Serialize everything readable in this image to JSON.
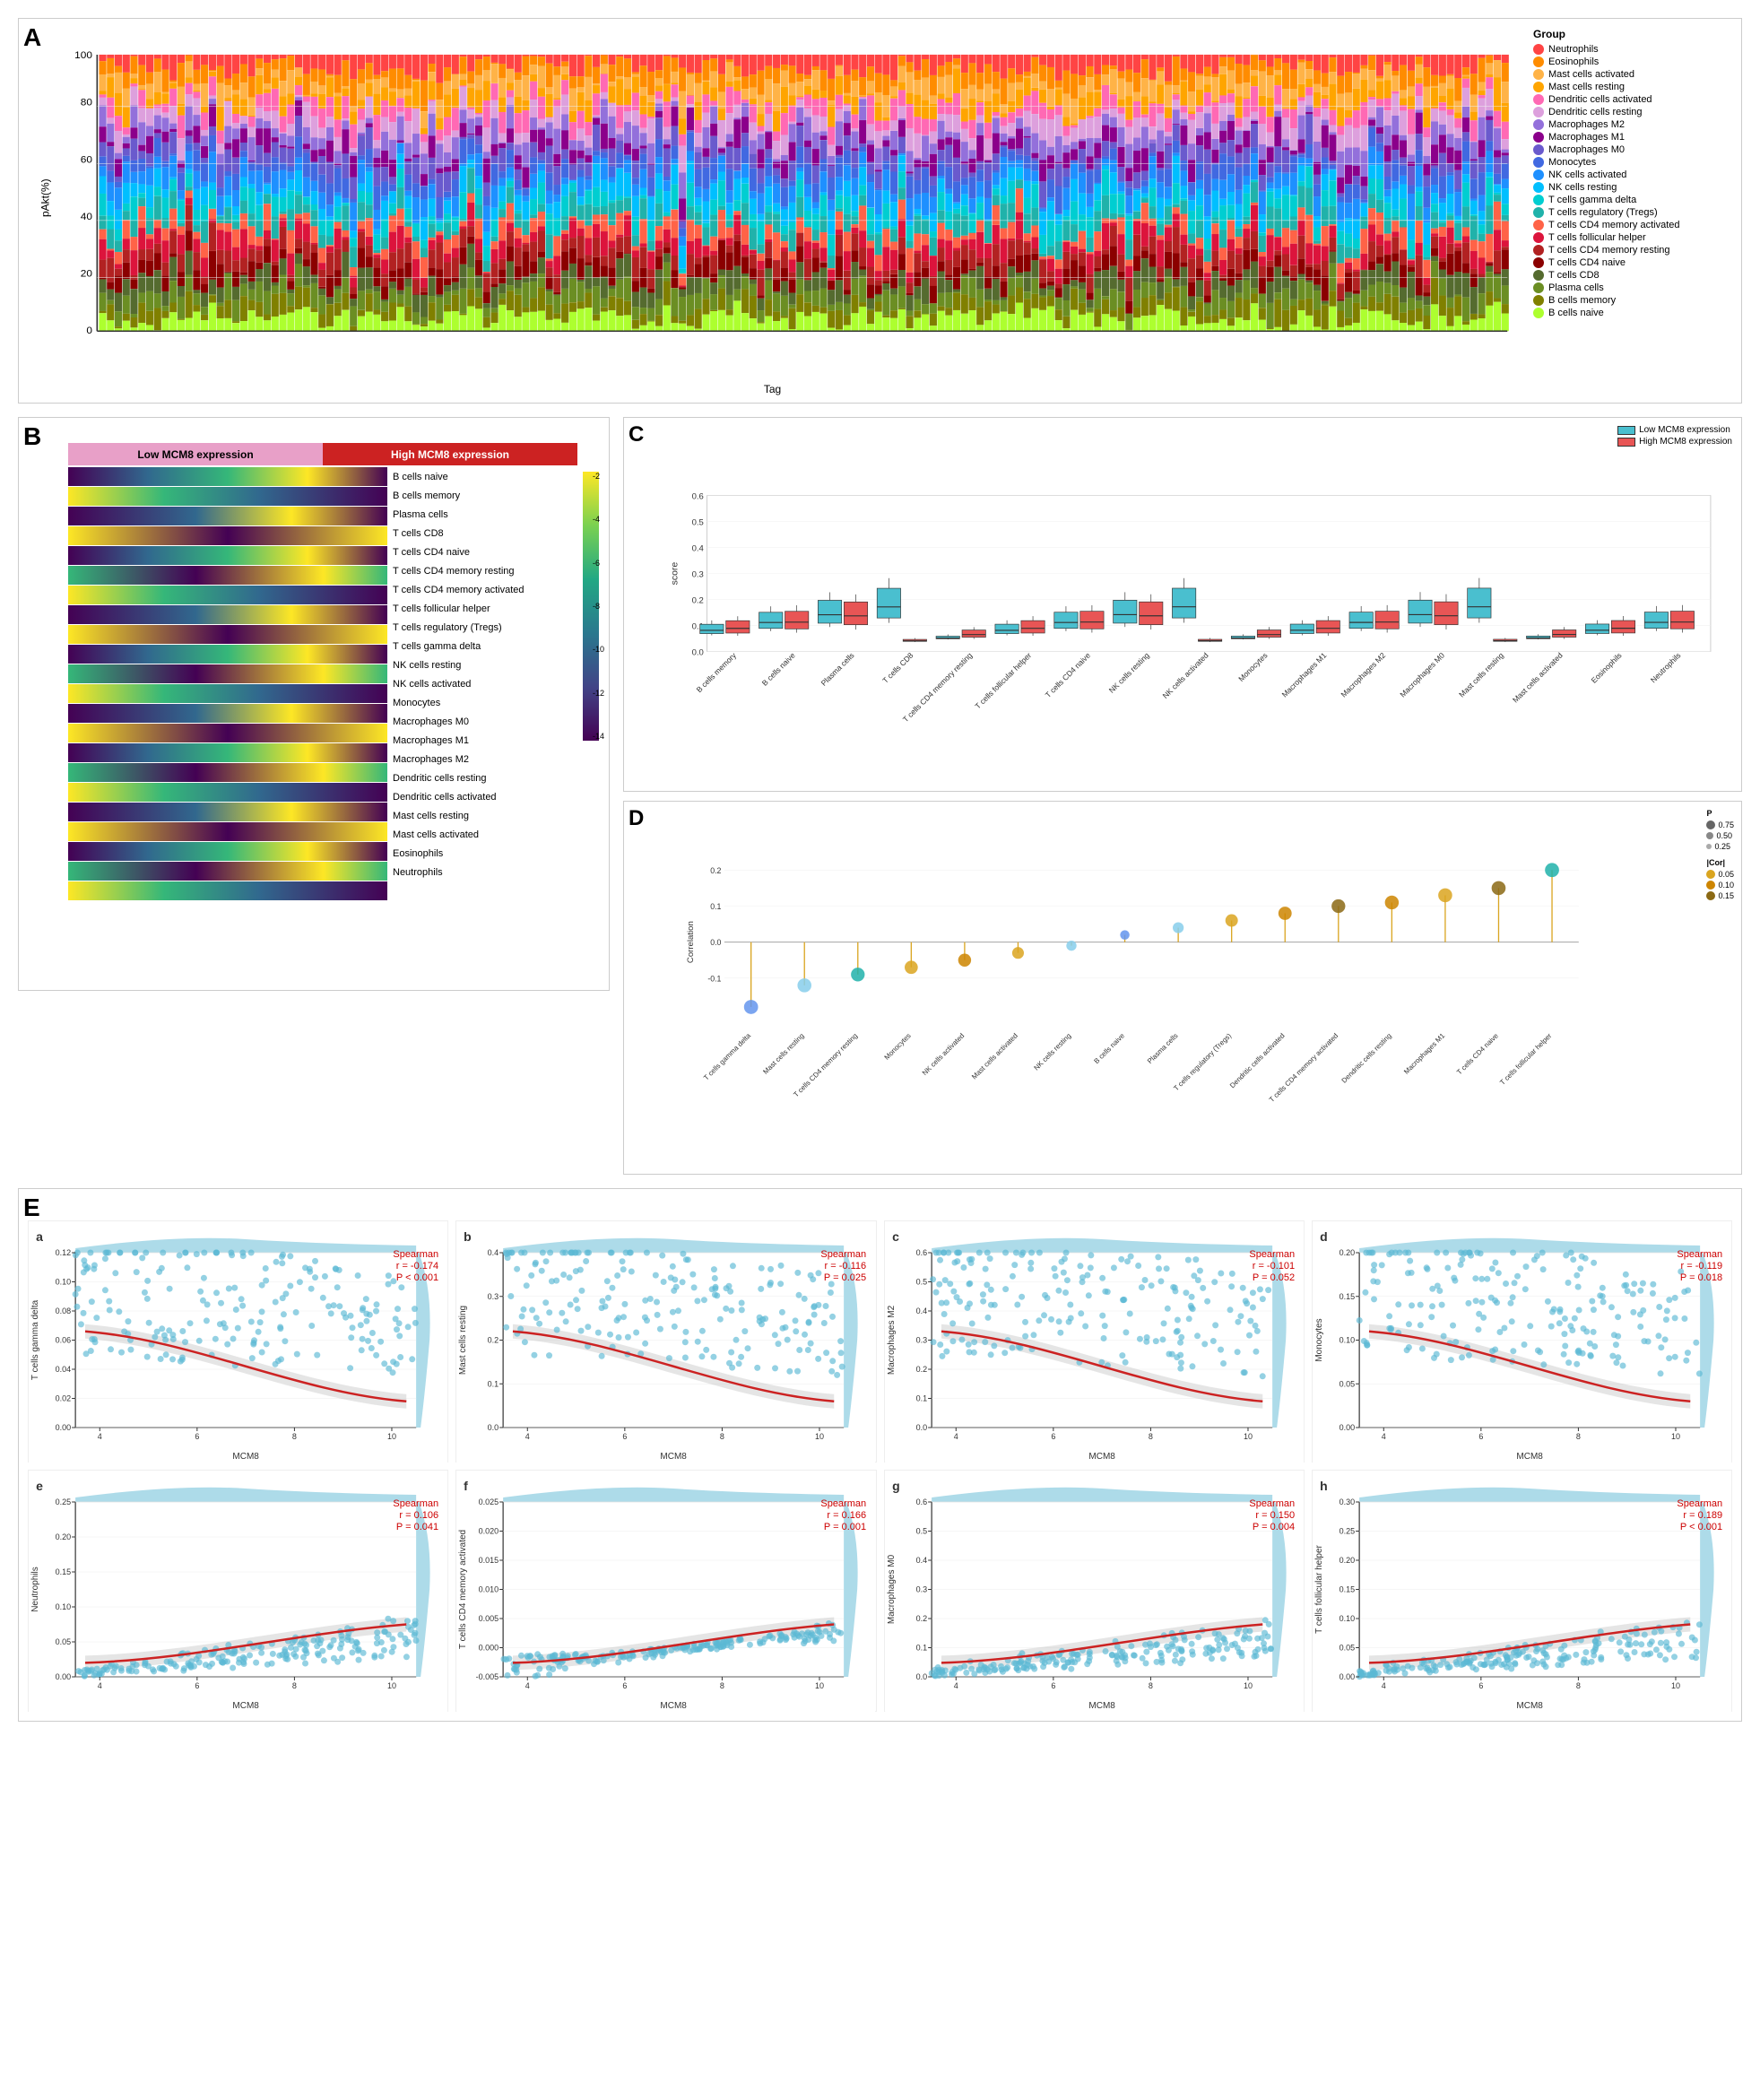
{
  "panels": {
    "a": {
      "label": "A",
      "y_axis": "pAkt(%)",
      "x_axis": "Tag",
      "y_ticks": [
        "0",
        "20",
        "40",
        "60",
        "80",
        "100"
      ],
      "legend_title": "Group",
      "legend_items": [
        {
          "name": "Neutrophils",
          "color": "#FF4444"
        },
        {
          "name": "Eosinophils",
          "color": "#FF8C00"
        },
        {
          "name": "Mast cells activated",
          "color": "#FFB347"
        },
        {
          "name": "Mast cells resting",
          "color": "#FFA500"
        },
        {
          "name": "Dendritic cells activated",
          "color": "#FF69B4"
        },
        {
          "name": "Dendritic cells resting",
          "color": "#DDA0DD"
        },
        {
          "name": "Macrophages M2",
          "color": "#9370DB"
        },
        {
          "name": "Macrophages M1",
          "color": "#8B008B"
        },
        {
          "name": "Macrophages M0",
          "color": "#6A5ACD"
        },
        {
          "name": "Monocytes",
          "color": "#4169E1"
        },
        {
          "name": "NK cells activated",
          "color": "#1E90FF"
        },
        {
          "name": "NK cells resting",
          "color": "#00BFFF"
        },
        {
          "name": "T cells gamma delta",
          "color": "#00CED1"
        },
        {
          "name": "T cells regulatory (Tregs)",
          "color": "#20B2AA"
        },
        {
          "name": "T cells CD4 memory activated",
          "color": "#FF6347"
        },
        {
          "name": "T cells follicular helper",
          "color": "#DC143C"
        },
        {
          "name": "T cells CD4 memory resting",
          "color": "#B22222"
        },
        {
          "name": "T cells CD4 naive",
          "color": "#8B0000"
        },
        {
          "name": "T cells CD8",
          "color": "#556B2F"
        },
        {
          "name": "Plasma cells",
          "color": "#6B8E23"
        },
        {
          "name": "B cells memory",
          "color": "#808000"
        },
        {
          "name": "B cells naive",
          "color": "#ADFF2F"
        }
      ]
    },
    "b": {
      "label": "B",
      "low_label": "Low MCM8 expression",
      "high_label": "High MCM8 expression",
      "cell_types": [
        "B cells naive",
        "B cells memory",
        "Plasma cells",
        "T cells CD8",
        "T cells CD4 naive",
        "T cells CD4 memory resting",
        "T cells CD4 memory activated",
        "T cells follicular helper",
        "T cells regulatory (Tregs)",
        "T cells gamma delta",
        "NK cells resting",
        "NK cells activated",
        "Monocytes",
        "Macrophages M0",
        "Macrophages M1",
        "Macrophages M2",
        "Dendritic cells resting",
        "Dendritic cells activated",
        "Mast cells resting",
        "Mast cells activated",
        "Eosinophils",
        "Neutrophils"
      ],
      "colorbar_values": [
        "-2",
        "-4",
        "-6",
        "-8",
        "-10",
        "-12",
        "-14"
      ]
    },
    "c": {
      "label": "C",
      "legend": {
        "low": "Low MCM8 expression",
        "high": "High MCM8 expression"
      },
      "x_labels": [
        "B cells memory",
        "B cells naive",
        "Plasma cells",
        "T cells CD8",
        "T cells CD4 memory resting",
        "T cells follicular helper",
        "T cells CD4 naive",
        "NK cells resting",
        "NK cells activated",
        "Monocytes",
        "Macrophages M1",
        "Macrophages M2",
        "Macrophages M0",
        "Mast cells resting",
        "Mast cells activated",
        "Eosinophils",
        "Neutrophils"
      ]
    },
    "d": {
      "label": "D",
      "y_label": "Correlation",
      "p_legend": [
        "0.75",
        "0.50",
        "0.25"
      ],
      "cor_legend": [
        "0.05",
        "0.10",
        "0.15"
      ],
      "x_labels": [
        "T cells gamma delta",
        "Mast cells resting",
        "T cells CD4 memory resting",
        "Monocytes",
        "NK cells activated",
        "Mast cells activated",
        "NK cells resting",
        "B cells naive",
        "Plasma cells",
        "T cells regulatory (Tregs)",
        "Dendritic cells activated",
        "T cells CD4 memory activated",
        "Dendritic cells resting",
        "Macrophages M1",
        "T cells CD4 naive",
        "T cells follicular helper"
      ]
    },
    "e": {
      "label": "E",
      "subplots": [
        {
          "id": "a",
          "y_label": "T cells gamma delta",
          "x_label": "MCM8",
          "spearman": "Spearman",
          "r": "r = -0.174",
          "p": "P < 0.001",
          "x_ticks": [
            "4",
            "6",
            "8",
            "10"
          ],
          "y_ticks": [
            "0.00",
            "0.02",
            "0.04",
            "0.06",
            "0.08",
            "0.10",
            "0.12"
          ]
        },
        {
          "id": "b",
          "y_label": "Mast cells resting",
          "x_label": "MCM8",
          "spearman": "Spearman",
          "r": "r = -0.116",
          "p": "P = 0.025",
          "x_ticks": [
            "4",
            "6",
            "8",
            "10"
          ],
          "y_ticks": [
            "0.0",
            "0.1",
            "0.2",
            "0.3",
            "0.4"
          ]
        },
        {
          "id": "c",
          "y_label": "Macrophages M2",
          "x_label": "MCM8",
          "spearman": "Spearman",
          "r": "r = -0.101",
          "p": "P = 0.052",
          "x_ticks": [
            "4",
            "6",
            "8",
            "10"
          ],
          "y_ticks": [
            "0.0",
            "0.1",
            "0.2",
            "0.3",
            "0.4",
            "0.5",
            "0.6"
          ]
        },
        {
          "id": "d",
          "y_label": "Monocytes",
          "x_label": "MCM8",
          "spearman": "Spearman",
          "r": "r = -0.119",
          "p": "P = 0.018",
          "x_ticks": [
            "4",
            "6",
            "8",
            "10"
          ],
          "y_ticks": [
            "0.00",
            "0.05",
            "0.10",
            "0.15",
            "0.20"
          ]
        },
        {
          "id": "e",
          "y_label": "Neutrophils",
          "x_label": "MCM8",
          "spearman": "Spearman",
          "r": "r = 0.106",
          "p": "P = 0.041",
          "x_ticks": [
            "4",
            "6",
            "8",
            "10"
          ],
          "y_ticks": [
            "0.00",
            "0.05",
            "0.10",
            "0.15",
            "0.20",
            "0.25"
          ]
        },
        {
          "id": "f",
          "y_label": "T cells CD4 memory activated",
          "x_label": "MCM8",
          "spearman": "Spearman",
          "r": "r = 0.166",
          "p": "P = 0.001",
          "x_ticks": [
            "4",
            "6",
            "8",
            "10"
          ],
          "y_ticks": [
            "-0.005",
            "0.000",
            "0.005",
            "0.010",
            "0.015",
            "0.020",
            "0.025"
          ]
        },
        {
          "id": "g",
          "y_label": "Macrophages M0",
          "x_label": "MCM8",
          "spearman": "Spearman",
          "r": "r = 0.150",
          "p": "P = 0.004",
          "x_ticks": [
            "4",
            "6",
            "8",
            "10"
          ],
          "y_ticks": [
            "0.0",
            "0.1",
            "0.2",
            "0.3",
            "0.4",
            "0.5",
            "0.6"
          ]
        },
        {
          "id": "h",
          "y_label": "T cells follicular helper",
          "x_label": "MCM8",
          "spearman": "Spearman",
          "r": "r = 0.189",
          "p": "P < 0.001",
          "x_ticks": [
            "4",
            "6",
            "8",
            "10"
          ],
          "y_ticks": [
            "0.00",
            "0.05",
            "0.10",
            "0.15",
            "0.20",
            "0.25",
            "0.30"
          ]
        }
      ]
    }
  }
}
